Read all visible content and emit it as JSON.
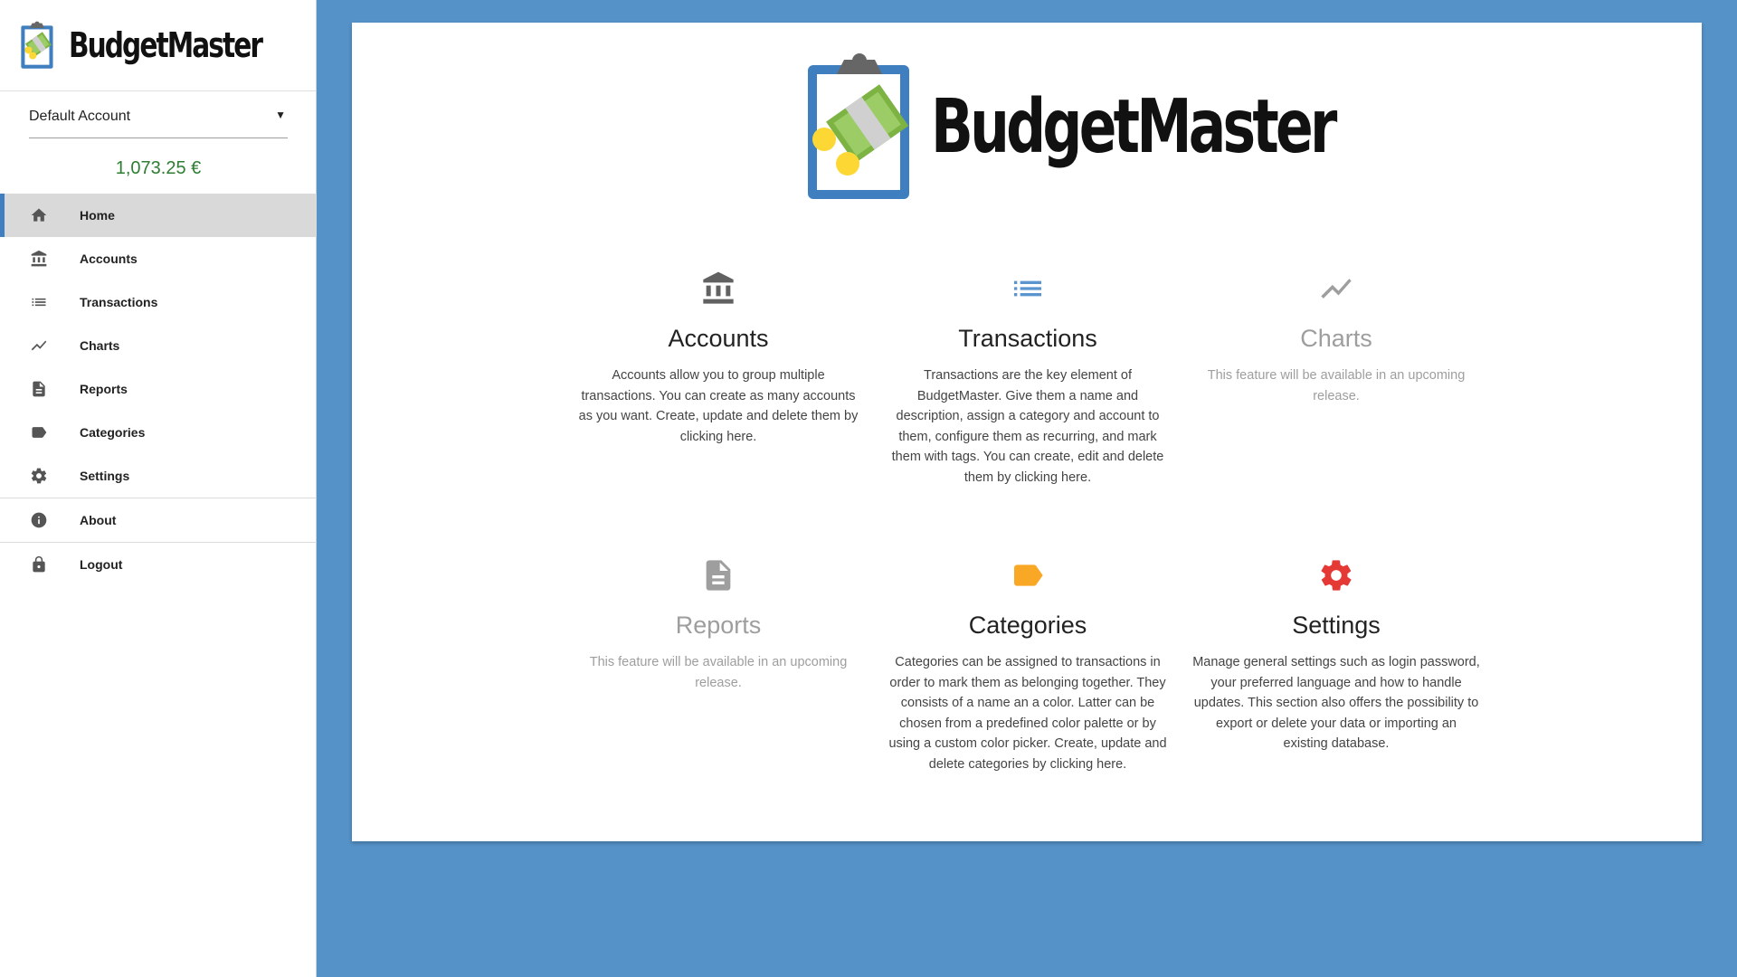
{
  "app": {
    "name": "BudgetMaster"
  },
  "sidebar": {
    "account_select": {
      "value": "Default Account"
    },
    "balance": "1,073.25 €",
    "items": [
      {
        "label": "Home",
        "icon": "home-icon"
      },
      {
        "label": "Accounts",
        "icon": "bank-icon"
      },
      {
        "label": "Transactions",
        "icon": "list-icon"
      },
      {
        "label": "Charts",
        "icon": "chart-line-icon"
      },
      {
        "label": "Reports",
        "icon": "document-icon"
      },
      {
        "label": "Categories",
        "icon": "label-icon"
      },
      {
        "label": "Settings",
        "icon": "gear-icon"
      },
      {
        "label": "About",
        "icon": "info-icon"
      },
      {
        "label": "Logout",
        "icon": "lock-icon"
      }
    ]
  },
  "main": {
    "title": "BudgetMaster",
    "features": [
      {
        "title": "Accounts",
        "icon": "bank-icon",
        "color": "#616161",
        "description": "Accounts allow you to group multiple transactions. You can create as many accounts as you want. Create, update and delete them by clicking here."
      },
      {
        "title": "Transactions",
        "icon": "list-icon",
        "color": "#5a95cf",
        "description": "Transactions are the key element of BudgetMaster. Give them a name and description, assign a category and account to them, configure them as recurring, and mark them with tags. You can create, edit and delete them by clicking here."
      },
      {
        "title": "Charts",
        "icon": "chart-line-icon",
        "color": "#9e9e9e",
        "description": "This feature will be available in an upcoming release."
      },
      {
        "title": "Reports",
        "icon": "document-icon",
        "color": "#9e9e9e",
        "description": "This feature will be available in an upcoming release."
      },
      {
        "title": "Categories",
        "icon": "label-icon",
        "color": "#f9a825",
        "description": "Categories can be assigned to transactions in order to mark them as belonging together. They consists of a name an a color. Latter can be chosen from a predefined color palette or by using a custom color picker. Create, update and delete categories by clicking here."
      },
      {
        "title": "Settings",
        "icon": "gear-icon",
        "color": "#e53935",
        "description": "Manage general settings such as login password, your preferred language and how to handle updates. This section also offers the possibility to export or delete your data or importing an existing database."
      }
    ]
  },
  "colors": {
    "background": "#5592c8",
    "active_indicator": "#3f7fc0",
    "balance": "#2e7d32"
  }
}
